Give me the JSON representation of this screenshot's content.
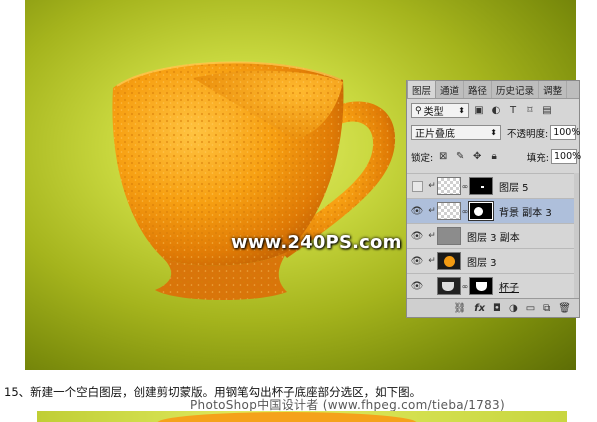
{
  "image": {
    "watermark": "www.240PS.com"
  },
  "layers_panel": {
    "tabs": [
      "图层",
      "通道",
      "路径",
      "历史记录",
      "调整"
    ],
    "tab_menu_icon": "panel-menu-icon",
    "filter_kind": "类型",
    "blend_mode": "正片叠底",
    "opacity_label": "不透明度:",
    "opacity_value": "100%",
    "lock_label": "锁定:",
    "fill_label": "填充:",
    "fill_value": "100%",
    "layers": [
      {
        "name": "图层 5",
        "visible": false,
        "clipped": true,
        "selected": false
      },
      {
        "name": "背景 副本 3",
        "visible": true,
        "clipped": true,
        "selected": true
      },
      {
        "name": "图层 3 副本",
        "visible": true,
        "clipped": true,
        "selected": false
      },
      {
        "name": "图层 3",
        "visible": true,
        "clipped": true,
        "selected": false
      },
      {
        "name": "杯子",
        "visible": true,
        "clipped": false,
        "selected": false
      }
    ],
    "footer_icons": [
      "link-icon",
      "fx-icon",
      "add-mask-icon",
      "adjustment-icon",
      "folder-icon",
      "new-layer-icon"
    ]
  },
  "caption": "15、新建一个空白图层，创建剪切蒙版。用钢笔勾出杯子底座部分选区，如下图。",
  "bottom_watermark": "PhotoShop中国设计者 (www.fhpeg.com/tieba/1783)"
}
